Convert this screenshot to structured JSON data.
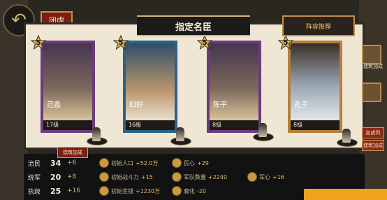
{
  "header": {
    "title": "指定名臣",
    "side_tab": "团虐",
    "recommend_button": "阵容推荐",
    "back_icon": "back-arrow-icon"
  },
  "cards": [
    {
      "name": "范蠡",
      "level": "17级",
      "star": "5",
      "frame": "purple"
    },
    {
      "name": "妇好",
      "level": "16级",
      "star": "5",
      "frame": "blue"
    },
    {
      "name": "陈平",
      "level": "8级",
      "star": "5",
      "frame": "purple"
    },
    {
      "name": "孔子",
      "level": "8级",
      "star": "5",
      "frame": "gold"
    }
  ],
  "ribbon": "建筑加成",
  "stats": [
    {
      "label": "治民",
      "value": "34",
      "inc": "+6",
      "chips": [
        {
          "text": "初始人口",
          "num": "+52.0万"
        },
        {
          "text": "民心",
          "num": "+29"
        }
      ]
    },
    {
      "label": "统军",
      "value": "20",
      "inc": "+8",
      "chips": [
        {
          "text": "初始战斗力",
          "num": "+15"
        },
        {
          "text": "军队数量",
          "num": "+2240"
        },
        {
          "text": "军心",
          "num": "+16"
        }
      ]
    },
    {
      "label": "执政",
      "value": "25",
      "inc": "+16",
      "chips": [
        {
          "text": "初始金钱",
          "num": "+1230万"
        },
        {
          "text": "腐化",
          "num": "-20"
        }
      ]
    }
  ],
  "right_panel": {
    "label": "建筑加成",
    "button1": "加成列",
    "button2": "建筑加成"
  },
  "colors": {
    "purple_frame": "#6d3c7c",
    "blue_frame": "#2b6289",
    "gold_frame": "#b5803b",
    "accent": "#f0a21f"
  }
}
